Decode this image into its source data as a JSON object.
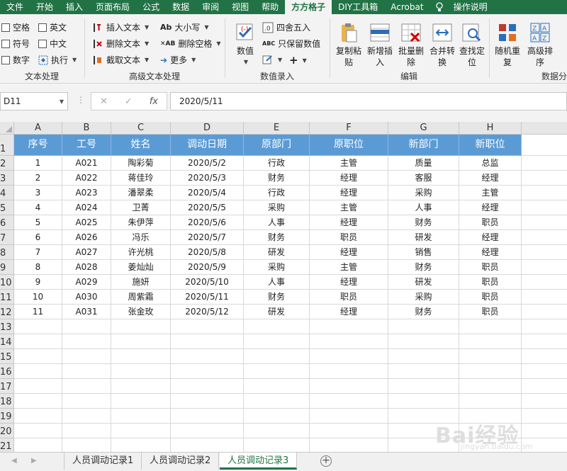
{
  "ribbon_tabs": [
    "文件",
    "开始",
    "插入",
    "页面布局",
    "公式",
    "数据",
    "审阅",
    "视图",
    "帮助",
    "方方格子",
    "DIY工具箱",
    "Acrobat",
    "操作说明"
  ],
  "active_tab": "方方格子",
  "text_group": {
    "checkboxes": [
      "空格",
      "英文",
      "符号",
      "中文",
      "数字",
      "执行"
    ],
    "label": "文本处理"
  },
  "adv_text_group": {
    "buttons": [
      "插入文本",
      "删除文本",
      "截取文本",
      "大小写",
      "删除空格",
      "更多"
    ],
    "label": "高级文本处理"
  },
  "value_group": {
    "big_button": "数值",
    "buttons": [
      "四舍五入",
      "只保留数值"
    ],
    "label": "数值录入"
  },
  "edit_group": {
    "buttons": [
      "复制粘贴",
      "新增插入",
      "批量删除",
      "合并转换",
      "查找定位"
    ],
    "label": "编辑"
  },
  "sort_group": {
    "buttons": [
      "随机重复",
      "高级排序"
    ],
    "label": "数据分"
  },
  "formula_bar": {
    "name_box": "D11",
    "fx_label": "fx",
    "value": "2020/5/11"
  },
  "sheet": {
    "columns": [
      "A",
      "B",
      "C",
      "D",
      "E",
      "F",
      "G",
      "H"
    ],
    "row_numbers": [
      "1",
      "2",
      "3",
      "4",
      "5",
      "6",
      "7",
      "8",
      "9",
      "10",
      "11",
      "12",
      "13",
      "14",
      "15",
      "16",
      "17",
      "18",
      "19",
      "20",
      "21"
    ],
    "header": [
      "序号",
      "工号",
      "姓名",
      "调动日期",
      "原部门",
      "原职位",
      "新部门",
      "新职位"
    ],
    "rows": [
      [
        "1",
        "A021",
        "陶彩菊",
        "2020/5/2",
        "行政",
        "主管",
        "质量",
        "总监"
      ],
      [
        "2",
        "A022",
        "蒋佳玲",
        "2020/5/3",
        "财务",
        "经理",
        "客服",
        "经理"
      ],
      [
        "3",
        "A023",
        "潘翠柔",
        "2020/5/4",
        "行政",
        "经理",
        "采购",
        "主管"
      ],
      [
        "4",
        "A024",
        "卫菁",
        "2020/5/5",
        "采购",
        "主管",
        "人事",
        "经理"
      ],
      [
        "5",
        "A025",
        "朱伊萍",
        "2020/5/6",
        "人事",
        "经理",
        "财务",
        "职员"
      ],
      [
        "6",
        "A026",
        "冯乐",
        "2020/5/7",
        "财务",
        "职员",
        "研发",
        "经理"
      ],
      [
        "7",
        "A027",
        "许光桃",
        "2020/5/8",
        "研发",
        "经理",
        "销售",
        "经理"
      ],
      [
        "8",
        "A028",
        "姜灿灿",
        "2020/5/9",
        "采购",
        "主管",
        "财务",
        "职员"
      ],
      [
        "9",
        "A029",
        "施妍",
        "2020/5/10",
        "人事",
        "经理",
        "研发",
        "职员"
      ],
      [
        "10",
        "A030",
        "周紫霜",
        "2020/5/11",
        "财务",
        "职员",
        "采购",
        "职员"
      ],
      [
        "11",
        "A031",
        "张金玫",
        "2020/5/12",
        "研发",
        "经理",
        "财务",
        "职员"
      ]
    ]
  },
  "sheet_tabs": [
    "人员调动记录1",
    "人员调动记录2",
    "人员调动记录3"
  ],
  "active_sheet": "人员调动记录3",
  "watermark": "Bai经验",
  "watermark_sub": "jingyan.baidu.com",
  "colors": {
    "excel_green": "#217346",
    "header_fill": "#5b9bd5",
    "header_text": "#ffffff"
  }
}
